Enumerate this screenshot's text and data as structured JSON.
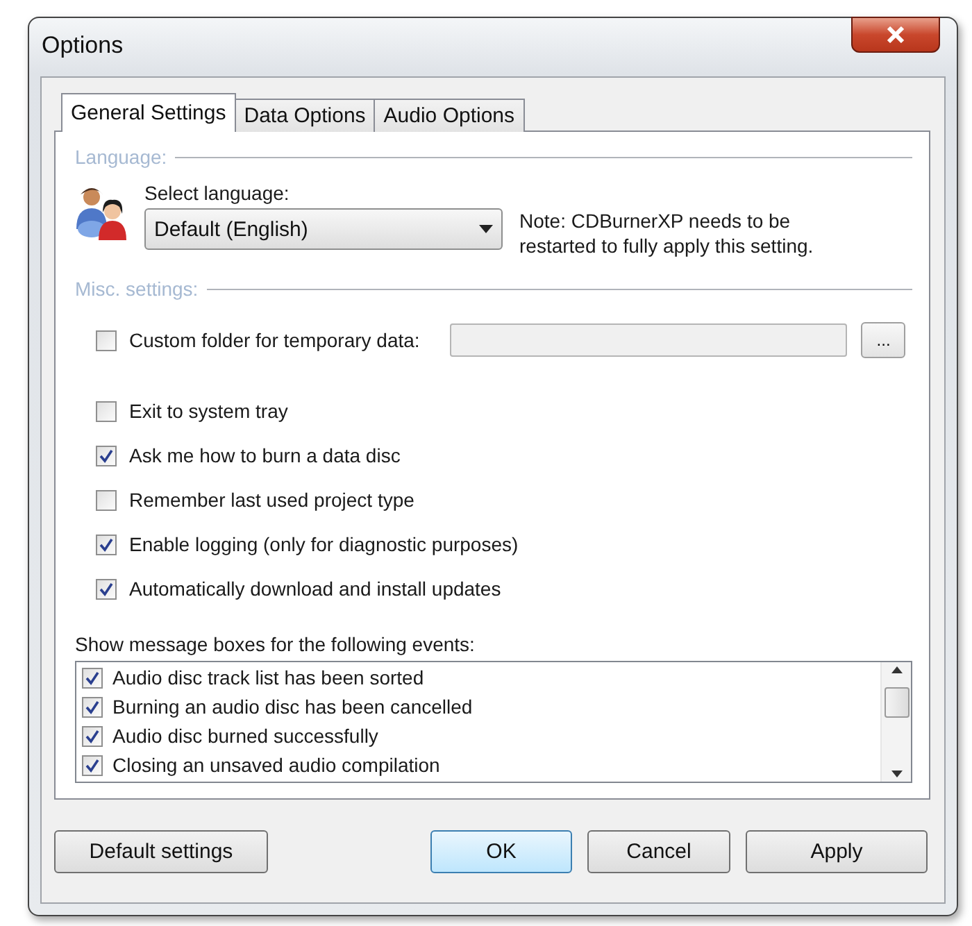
{
  "window": {
    "title": "Options"
  },
  "tabs": [
    {
      "label": "General Settings",
      "selected": true
    },
    {
      "label": "Data Options",
      "selected": false
    },
    {
      "label": "Audio Options",
      "selected": false
    }
  ],
  "language": {
    "heading": "Language:",
    "label": "Select language:",
    "value": "Default (English)",
    "note": "Note: CDBurnerXP needs to be restarted to fully apply this setting."
  },
  "misc": {
    "heading": "Misc. settings:",
    "custom_folder": {
      "label": "Custom folder for temporary data:",
      "checked": false,
      "field_disabled": true,
      "browse": "..."
    },
    "options": [
      {
        "label": "Exit to system tray",
        "checked": false
      },
      {
        "label": "Ask me how to burn a data disc",
        "checked": true
      },
      {
        "label": "Remember last used project type",
        "checked": false
      },
      {
        "label": "Enable logging (only for diagnostic purposes)",
        "checked": true
      },
      {
        "label": "Automatically download and install updates",
        "checked": true
      }
    ],
    "events_label": "Show message boxes for the following events:",
    "events": [
      {
        "label": "Audio disc track list has been sorted",
        "checked": true
      },
      {
        "label": "Burning an audio disc has been cancelled",
        "checked": true
      },
      {
        "label": "Audio disc burned successfully",
        "checked": true
      },
      {
        "label": "Closing an unsaved audio compilation",
        "checked": true
      }
    ]
  },
  "buttons": [
    {
      "label": "Default settings",
      "focused": false
    },
    {
      "label": "OK",
      "focused": true
    },
    {
      "label": "Cancel",
      "focused": false
    },
    {
      "label": "Apply",
      "focused": false
    }
  ]
}
